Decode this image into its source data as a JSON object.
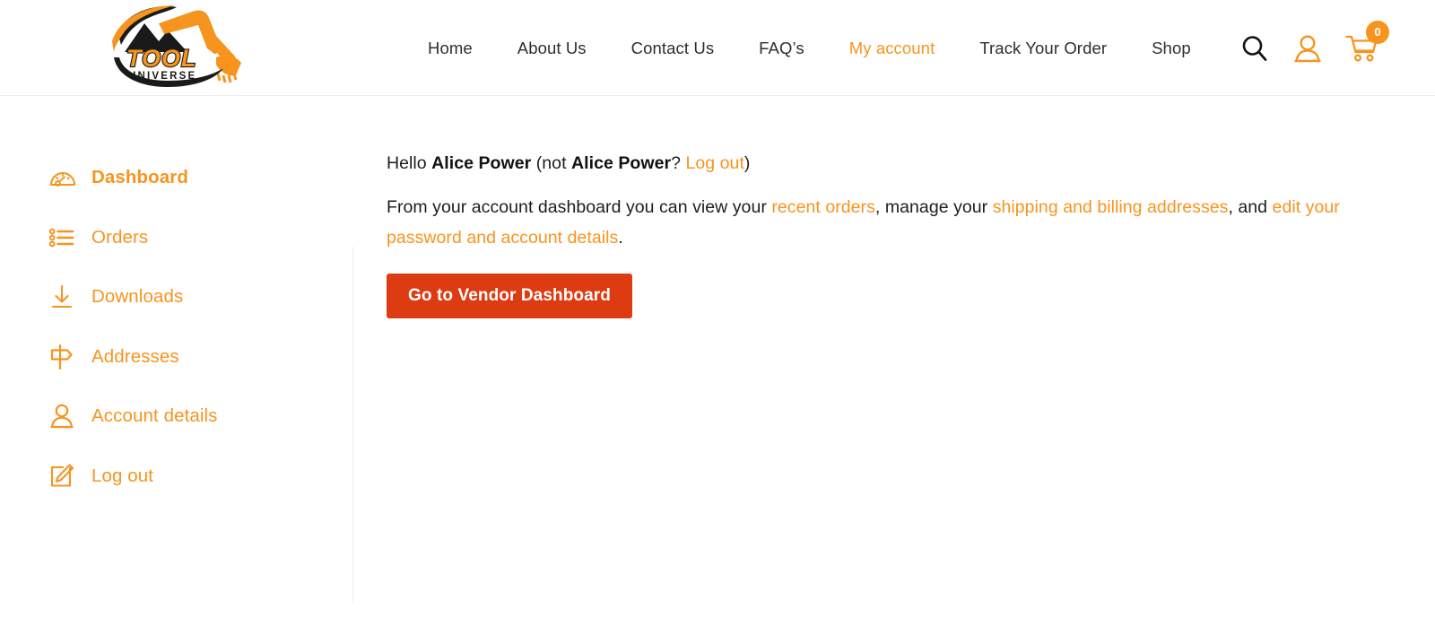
{
  "header": {
    "logo": {
      "name": "tool-universe-logo",
      "text_top": "TOOL",
      "text_bottom": "UNIVERSE"
    },
    "nav": [
      {
        "label": "Home",
        "active": false
      },
      {
        "label": "About Us",
        "active": false
      },
      {
        "label": "Contact Us",
        "active": false
      },
      {
        "label": "FAQ’s",
        "active": false
      },
      {
        "label": "My account",
        "active": true
      },
      {
        "label": "Track Your Order",
        "active": false
      },
      {
        "label": "Shop",
        "active": false
      }
    ],
    "icons": {
      "search": "search-icon",
      "account": "user-icon",
      "cart": "cart-icon"
    },
    "cart_count": "0"
  },
  "sidebar": {
    "items": [
      {
        "label": "Dashboard",
        "icon": "gauge-icon",
        "active": true
      },
      {
        "label": "Orders",
        "icon": "list-icon",
        "active": false
      },
      {
        "label": "Downloads",
        "icon": "download-icon",
        "active": false
      },
      {
        "label": "Addresses",
        "icon": "signpost-icon",
        "active": false
      },
      {
        "label": "Account details",
        "icon": "person-icon",
        "active": false
      },
      {
        "label": "Log out",
        "icon": "edit-note-icon",
        "active": false
      }
    ]
  },
  "main": {
    "greeting": {
      "hello": "Hello ",
      "user_name": "Alice Power",
      "not_open": " (not ",
      "user_name_2": "Alice Power",
      "question": "? ",
      "logout_link": "Log out",
      "close": ")"
    },
    "description": {
      "part1": "From your account dashboard you can view your ",
      "link_orders": "recent orders",
      "part2": ", manage your ",
      "link_addresses": "shipping and billing addresses",
      "part3": ", and ",
      "link_account": "edit your password and account details",
      "part4": "."
    },
    "vendor_button": "Go to Vendor Dashboard"
  },
  "colors": {
    "accent_orange": "#f7941e",
    "button_red": "#dd3c13",
    "text_dark": "#1d1d1d"
  }
}
